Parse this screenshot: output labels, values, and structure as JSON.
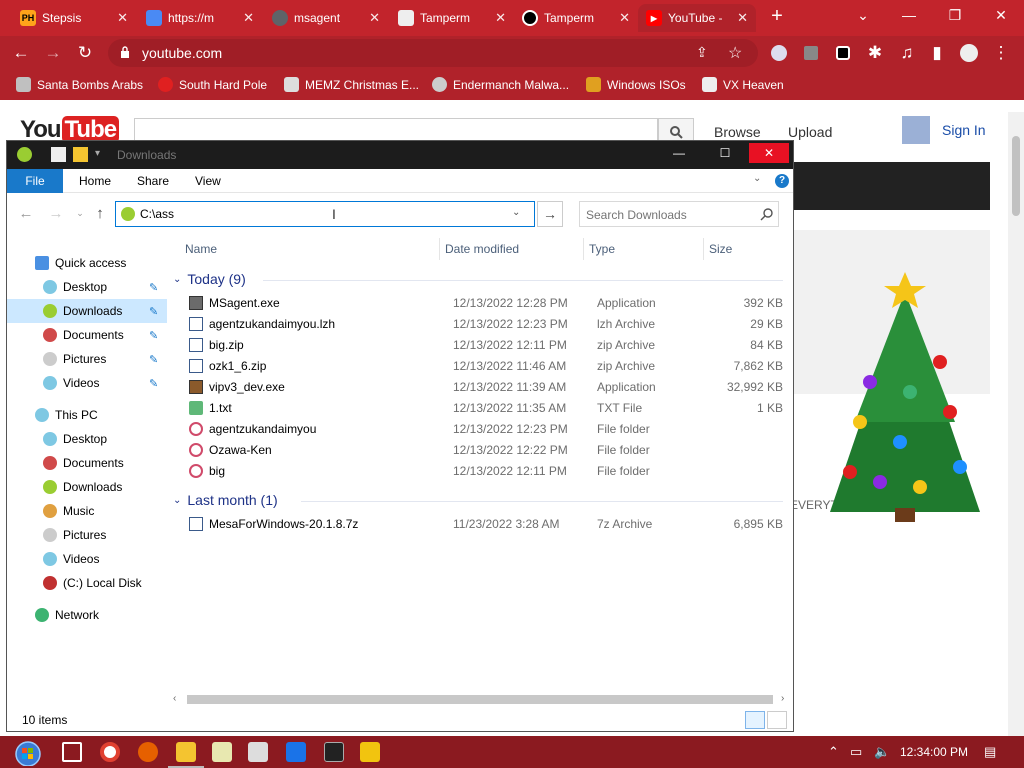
{
  "browser": {
    "tabs": [
      {
        "label": "Stepsis",
        "fav_text": "PH",
        "fav_color": "#ffa31a"
      },
      {
        "label": "https://m",
        "fav_text": "",
        "fav_color": "#4a8af4"
      },
      {
        "label": "msagent",
        "fav_text": "",
        "fav_color": "#5f6368"
      },
      {
        "label": "Tamperm",
        "fav_text": "",
        "fav_color": "#333333"
      },
      {
        "label": "Tamperm",
        "fav_text": "",
        "fav_color": "#000000"
      },
      {
        "label": "YouTube -",
        "fav_text": "",
        "fav_color": "#ff0000"
      }
    ],
    "url": "youtube.com",
    "bookmarks": [
      {
        "label": "Santa Bombs Arabs",
        "icon_color": "#c0c0c0"
      },
      {
        "label": "South Hard Pole",
        "icon_color": "#e02020"
      },
      {
        "label": "MEMZ Christmas E...",
        "icon_color": "#dddddd"
      },
      {
        "label": "Endermanch Malwa...",
        "icon_color": "#cccccc"
      },
      {
        "label": "Windows ISOs",
        "icon_color": "#e0a020"
      },
      {
        "label": "VX Heaven",
        "icon_color": "#eeeeee"
      }
    ],
    "accent": "#b0222a"
  },
  "youtube": {
    "logo_you": "You",
    "logo_tube": "Tube",
    "browse": "Browse",
    "upload": "Upload",
    "sign_in": "Sign In",
    "marquee": "EVERYTHING'S ... ! CODE:"
  },
  "explorer": {
    "title": "Downloads",
    "ribbon_tabs": {
      "file": "File",
      "home": "Home",
      "share": "Share",
      "view": "View"
    },
    "address_value": "C:\\ass",
    "search_placeholder": "Search Downloads",
    "sidebar": {
      "quick_access": "Quick access",
      "qa_items": [
        "Desktop",
        "Downloads",
        "Documents",
        "Pictures",
        "Videos"
      ],
      "this_pc": "This PC",
      "pc_items": [
        "Desktop",
        "Documents",
        "Downloads",
        "Music",
        "Pictures",
        "Videos",
        "(C:) Local Disk"
      ],
      "network": "Network"
    },
    "columns": {
      "name": "Name",
      "date": "Date modified",
      "type": "Type",
      "size": "Size"
    },
    "groups": [
      {
        "header": "Today (9)",
        "rows": [
          {
            "name": "MSagent.exe",
            "date": "12/13/2022 12:28 PM",
            "type": "Application",
            "size": "392 KB",
            "icon": "exe-icon"
          },
          {
            "name": "agentzukandaimyou.lzh",
            "date": "12/13/2022 12:23 PM",
            "type": "lzh Archive",
            "size": "29 KB",
            "icon": "archive-icon"
          },
          {
            "name": "big.zip",
            "date": "12/13/2022 12:11 PM",
            "type": "zip Archive",
            "size": "84 KB",
            "icon": "archive-icon"
          },
          {
            "name": "ozk1_6.zip",
            "date": "12/13/2022 11:46 AM",
            "type": "zip Archive",
            "size": "7,862 KB",
            "icon": "archive-icon"
          },
          {
            "name": "vipv3_dev.exe",
            "date": "12/13/2022 11:39 AM",
            "type": "Application",
            "size": "32,992 KB",
            "icon": "exe-icon"
          },
          {
            "name": "1.txt",
            "date": "12/13/2022 11:35 AM",
            "type": "TXT File",
            "size": "1 KB",
            "icon": "text-file-icon"
          },
          {
            "name": "agentzukandaimyou",
            "date": "12/13/2022 12:23 PM",
            "type": "File folder",
            "size": "",
            "icon": "folder-icon"
          },
          {
            "name": "Ozawa-Ken",
            "date": "12/13/2022 12:22 PM",
            "type": "File folder",
            "size": "",
            "icon": "folder-icon"
          },
          {
            "name": "big",
            "date": "12/13/2022 12:11 PM",
            "type": "File folder",
            "size": "",
            "icon": "folder-icon"
          }
        ]
      },
      {
        "header": "Last month (1)",
        "rows": [
          {
            "name": "MesaForWindows-20.1.8.7z",
            "date": "11/23/2022 3:28 AM",
            "type": "7z Archive",
            "size": "6,895 KB",
            "icon": "archive-icon"
          }
        ]
      }
    ],
    "status": "10 items",
    "file_tab_color": "#1979ca",
    "selection_color": "#cce8ff"
  },
  "taskbar": {
    "clock": "12:34:00 PM",
    "color": "#8b1a20"
  }
}
